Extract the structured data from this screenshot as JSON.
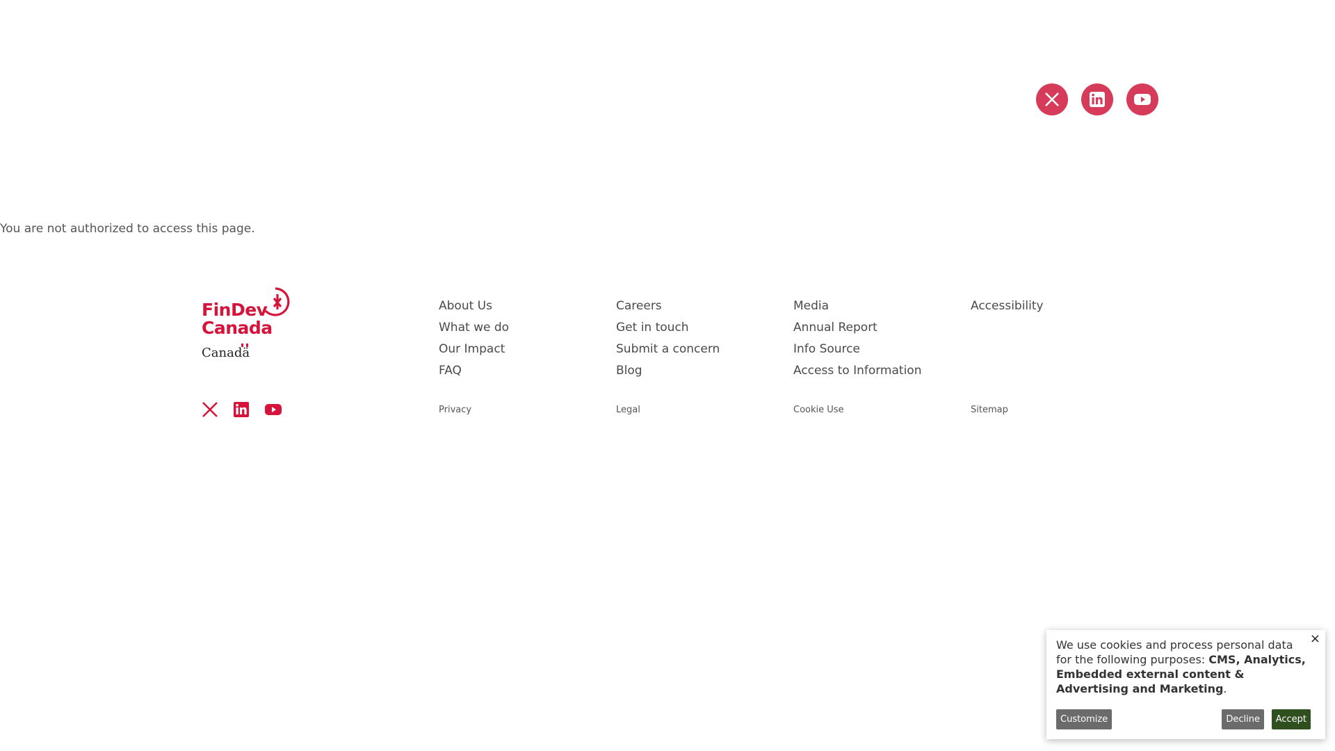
{
  "colors": {
    "brand_red": "#d6133a",
    "social_circle": "#d63b5a",
    "accept_green": "#2f4f1f",
    "button_gray": "#6b6b6b"
  },
  "header_social": [
    {
      "icon": "x-icon"
    },
    {
      "icon": "linkedin-icon"
    },
    {
      "icon": "youtube-icon"
    }
  ],
  "notice": "You are not authorized to access this page.",
  "logo": {
    "line1": "FinDev",
    "line2": "Canada",
    "wordmark": "Canadä"
  },
  "footer": {
    "col1": [
      "About Us",
      "What we do",
      "Our Impact",
      "FAQ"
    ],
    "col2": [
      "Careers",
      "Get in touch",
      "Submit a concern",
      "Blog"
    ],
    "col3": [
      "Media",
      "Annual Report",
      "Info Source",
      "Access to Information"
    ],
    "col4": [
      "Accessibility"
    ],
    "legal": [
      "Privacy",
      "Legal",
      "Cookie Use",
      "Sitemap"
    ]
  },
  "cookie": {
    "text_before": "We use cookies and process personal data for the following purposes: ",
    "purposes": "CMS, Analytics, Embedded external content & Advertising and Marketing",
    "text_after": ".",
    "close": "×",
    "customize": "Customize",
    "decline": "Decline",
    "accept": "Accept"
  }
}
